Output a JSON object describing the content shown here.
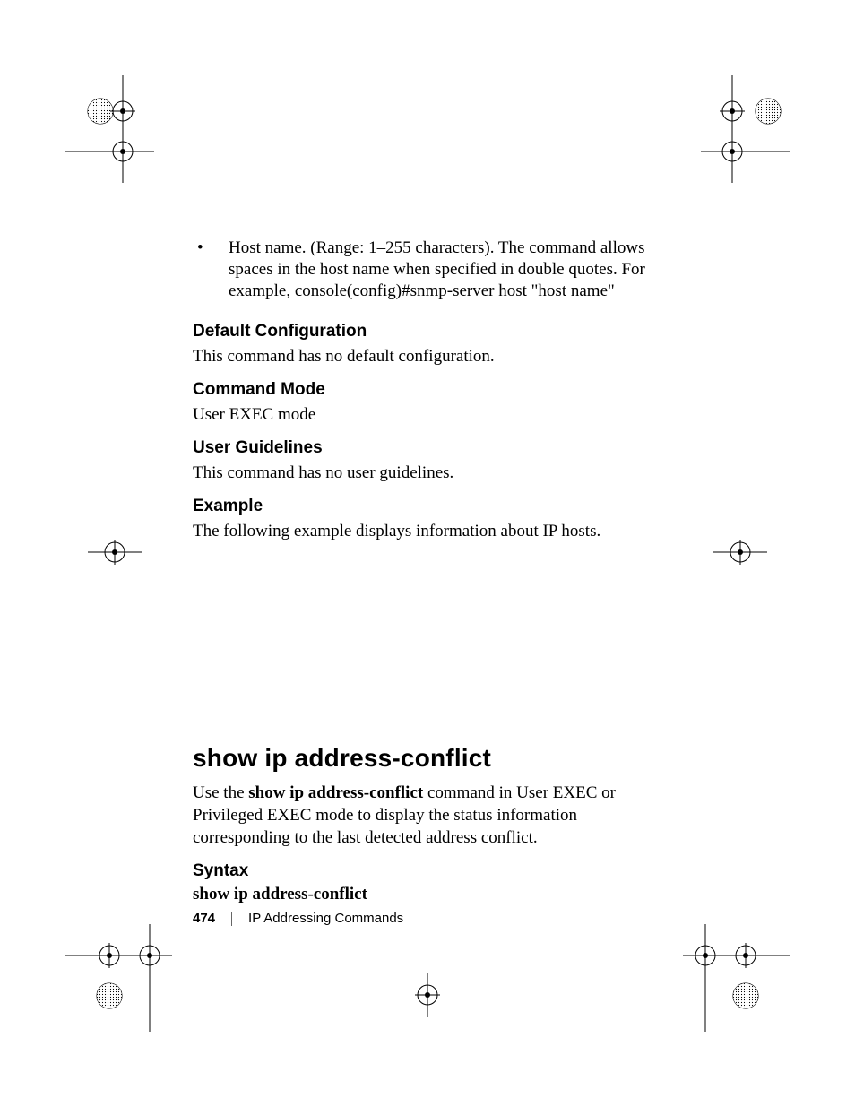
{
  "bullet": {
    "text": "Host name. (Range: 1–255 characters). The command allows spaces in the host name when specified in double quotes. For example, console(config)#snmp-server host \"host name\""
  },
  "sections": {
    "default_config": {
      "heading": "Default Configuration",
      "body": "This command has no default configuration."
    },
    "command_mode": {
      "heading": "Command Mode",
      "body": "User EXEC mode"
    },
    "user_guidelines": {
      "heading": "User Guidelines",
      "body": "This command has no user guidelines."
    },
    "example": {
      "heading": "Example",
      "body": "The following example displays information about IP hosts."
    }
  },
  "command": {
    "title": "show ip address-conflict",
    "intro_pre": "Use the ",
    "intro_bold": "show ip address-conflict",
    "intro_post": " command in User EXEC or Privileged EXEC mode to display the status information corresponding to the last detected address conflict.",
    "syntax_heading": "Syntax",
    "syntax_line": "show ip address-conflict"
  },
  "footer": {
    "page": "474",
    "chapter": "IP Addressing Commands"
  }
}
